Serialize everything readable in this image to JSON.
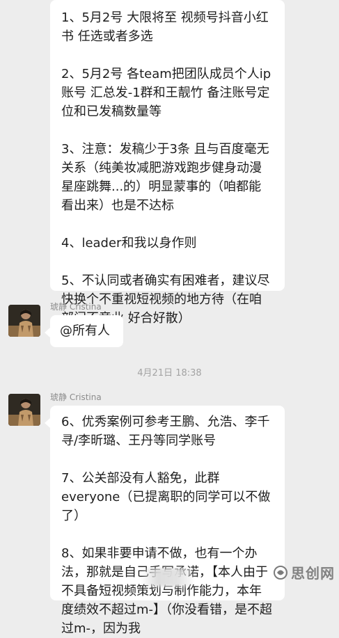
{
  "messages_top": [
    "1、5月2号 大限将至 视频号抖音小红书 任选或者多选",
    "2、5月2号 各team把团队成员个人ip账号 汇总发-1群和王靓竹 备注账号定位和已发稿数量等",
    "3、注意：发稿少于3条 且与百度毫无关系（纯美妆减肥游戏跑步健身动漫星座跳舞...的）明显蒙事的（咱都能看出来）也是不达标",
    "4、leader和我以身作则",
    "5、不认同或者确实有困难者，建议尽快换个不重视短视频的地方待（在咱部门不竞业 好合好散）"
  ],
  "sender_1": "琥静 Cristina",
  "message_at": "@所有人",
  "timestamp": "4月21日 18:38",
  "sender_2": "琥静 Cristina",
  "messages_bottom": [
    "6、优秀案例可参考王鹏、允浩、李千寻/李昕璐、王丹等同学账号",
    "7、公关部没有人豁免，此群everyone（已提离职的同学可以不做了）",
    "8、如果非要申请不做，也有一个办法，那就是自己手写承诺，【本人由于不具备短视频策划与制作能力，本年度绩效不超过m-】（你没看错，是不超过m-，因为我"
  ],
  "watermark": "思创网",
  "icons": {
    "avatar": "avatar-photo",
    "watermark_logo": "sichuang-logo-icon"
  }
}
